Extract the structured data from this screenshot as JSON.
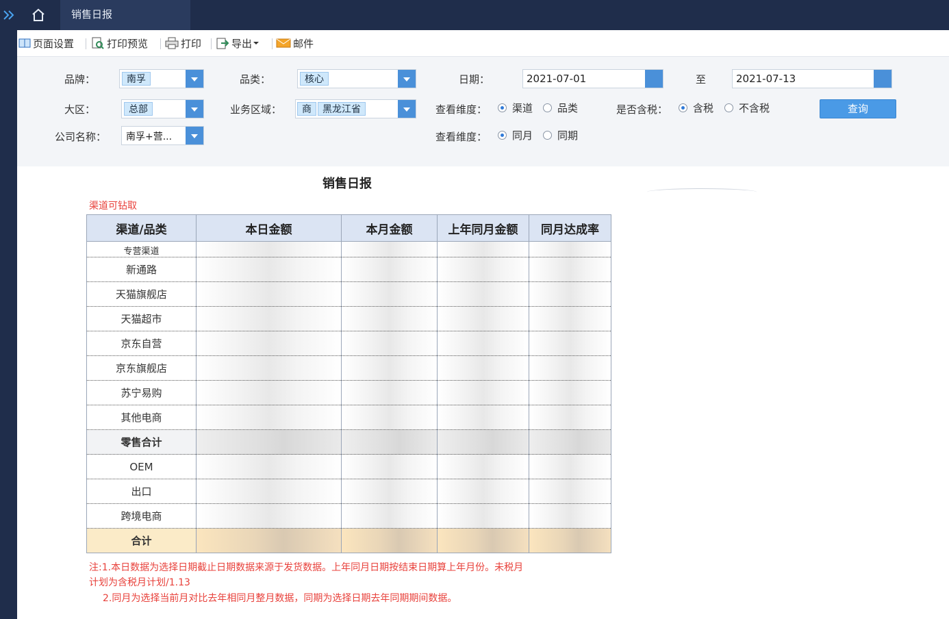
{
  "tab": {
    "title": "销售日报"
  },
  "toolbar": {
    "page_setup": "页面设置",
    "print_preview": "打印预览",
    "print": "打印",
    "export": "导出",
    "mail": "邮件"
  },
  "filters": {
    "brand_label": "品牌：",
    "brand_value": "南孚",
    "category_label": "品类：",
    "category_value": "核心",
    "date_label": "日期：",
    "date_from": "2021-07-01",
    "to_label": "至",
    "date_to": "2021-07-13",
    "region_label": "大区：",
    "region_value": "总部",
    "biz_area_label": "业务区域：",
    "biz_area_chip1": "商",
    "biz_area_chip2": "黑龙江省",
    "view_dim_label": "查看维度：",
    "view_dim_opt1": "渠道",
    "view_dim_opt2": "品类",
    "tax_label": "是否含税：",
    "tax_opt1": "含税",
    "tax_opt2": "不含税",
    "query_button": "查询",
    "company_label": "公司名称：",
    "company_value": "南孚+营...",
    "view_dim2_label": "查看维度：",
    "view_dim2_opt1": "同月",
    "view_dim2_opt2": "同期"
  },
  "report": {
    "title": "销售日报",
    "hint": "渠道可钻取",
    "headers": [
      "渠道/品类",
      "本日金额",
      "本月金额",
      "上年同月金额",
      "同月达成率"
    ],
    "partial_row": "专营渠道",
    "rows": [
      "新通路",
      "天猫旗舰店",
      "天猫超市",
      "京东自营",
      "京东旗舰店",
      "苏宁易购",
      "其他电商"
    ],
    "subtotal": "零售合计",
    "rows2": [
      "OEM",
      "出口",
      "跨境电商"
    ],
    "total": "合计",
    "note1": "注:1.本日数据为选择日期截止日期数据来源于发货数据。上年同月日期按结束日期算上年月份。未税月",
    "note2": "计划为含税月计划/1.13",
    "note3": "2.同月为选择当前月对比去年相同月整月数据，同期为选择日期去年同期期间数据。"
  },
  "colors": {
    "accent": "#4a90d9",
    "nav": "#1f2d4b",
    "note": "#e8413b",
    "total_row": "#fbebc8"
  }
}
